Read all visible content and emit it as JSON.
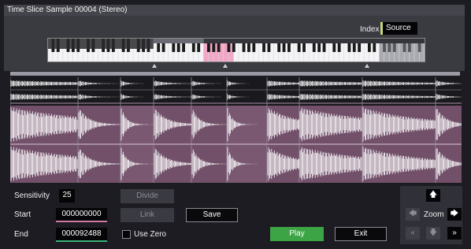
{
  "window": {
    "title": "Time Slice Sample 00004 (Stereo)"
  },
  "index": {
    "label": "Index",
    "value": "Source"
  },
  "sensitivity": {
    "label": "Sensitivity",
    "value": "25"
  },
  "start": {
    "label": "Start",
    "value": "000000000"
  },
  "end": {
    "label": "End",
    "value": "000092488"
  },
  "buttons": {
    "divide": "Divide",
    "link": "Link",
    "save": "Save",
    "use_zero": "Use Zero",
    "play": "Play",
    "exit": "Exit"
  },
  "zoom": {
    "label": "Zoom",
    "up_icon": "arrow-up",
    "down_icon": "arrow-down",
    "left_icon": "arrow-left",
    "right_icon": "arrow-right",
    "first_icon": "double-chevron-left",
    "last_icon": "double-chevron-right"
  },
  "colors": {
    "waveform_highlight": "#72506a",
    "waveform": "#ffffff",
    "play_button": "#3da446",
    "index_accent": "#c9d879",
    "start_underline": "#d27aa4",
    "end_underline": "#3cb37a"
  }
}
